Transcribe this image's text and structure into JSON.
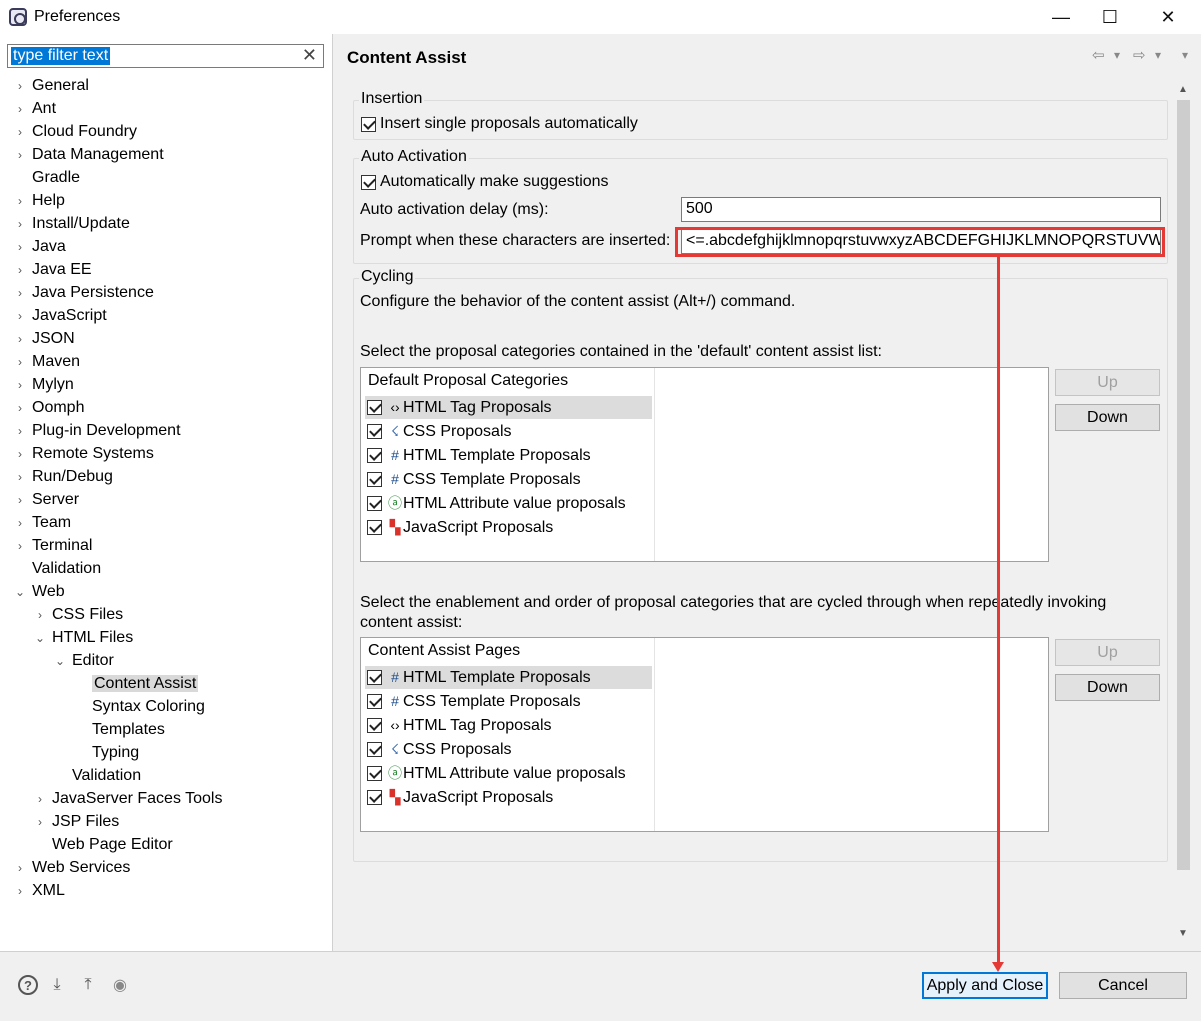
{
  "window": {
    "title": "Preferences",
    "minimize": "—",
    "maximize": "☐",
    "close": "✕"
  },
  "filter": {
    "placeholder": "type filter text",
    "clear": "✕"
  },
  "tree": [
    {
      "label": "General",
      "level": 0,
      "arrow": "›"
    },
    {
      "label": "Ant",
      "level": 0,
      "arrow": "›"
    },
    {
      "label": "Cloud Foundry",
      "level": 0,
      "arrow": "›"
    },
    {
      "label": "Data Management",
      "level": 0,
      "arrow": "›"
    },
    {
      "label": "Gradle",
      "level": 0,
      "arrow": ""
    },
    {
      "label": "Help",
      "level": 0,
      "arrow": "›"
    },
    {
      "label": "Install/Update",
      "level": 0,
      "arrow": "›"
    },
    {
      "label": "Java",
      "level": 0,
      "arrow": "›"
    },
    {
      "label": "Java EE",
      "level": 0,
      "arrow": "›"
    },
    {
      "label": "Java Persistence",
      "level": 0,
      "arrow": "›"
    },
    {
      "label": "JavaScript",
      "level": 0,
      "arrow": "›"
    },
    {
      "label": "JSON",
      "level": 0,
      "arrow": "›"
    },
    {
      "label": "Maven",
      "level": 0,
      "arrow": "›"
    },
    {
      "label": "Mylyn",
      "level": 0,
      "arrow": "›"
    },
    {
      "label": "Oomph",
      "level": 0,
      "arrow": "›"
    },
    {
      "label": "Plug-in Development",
      "level": 0,
      "arrow": "›"
    },
    {
      "label": "Remote Systems",
      "level": 0,
      "arrow": "›"
    },
    {
      "label": "Run/Debug",
      "level": 0,
      "arrow": "›"
    },
    {
      "label": "Server",
      "level": 0,
      "arrow": "›"
    },
    {
      "label": "Team",
      "level": 0,
      "arrow": "›"
    },
    {
      "label": "Terminal",
      "level": 0,
      "arrow": "›"
    },
    {
      "label": "Validation",
      "level": 0,
      "arrow": ""
    },
    {
      "label": "Web",
      "level": 0,
      "arrow": "⌄"
    },
    {
      "label": "CSS Files",
      "level": 1,
      "arrow": "›"
    },
    {
      "label": "HTML Files",
      "level": 1,
      "arrow": "⌄"
    },
    {
      "label": "Editor",
      "level": 2,
      "arrow": "⌄"
    },
    {
      "label": "Content Assist",
      "level": 3,
      "arrow": "",
      "selected": true
    },
    {
      "label": "Syntax Coloring",
      "level": 3,
      "arrow": ""
    },
    {
      "label": "Templates",
      "level": 3,
      "arrow": ""
    },
    {
      "label": "Typing",
      "level": 3,
      "arrow": ""
    },
    {
      "label": "Validation",
      "level": 2,
      "arrow": ""
    },
    {
      "label": "JavaServer Faces Tools",
      "level": 1,
      "arrow": "›"
    },
    {
      "label": "JSP Files",
      "level": 1,
      "arrow": "›"
    },
    {
      "label": "Web Page Editor",
      "level": 1,
      "arrow": ""
    },
    {
      "label": "Web Services",
      "level": 0,
      "arrow": "›"
    },
    {
      "label": "XML",
      "level": 0,
      "arrow": "›"
    }
  ],
  "page": {
    "heading": "Content Assist",
    "nav": {
      "back": "⇦",
      "back_menu": "▾",
      "forward": "⇨",
      "forward_menu": "▾",
      "view_menu": "▾"
    }
  },
  "insertion": {
    "legend": "Insertion",
    "single_proposals_label": "Insert single proposals automatically",
    "single_proposals_checked": true
  },
  "auto_activation": {
    "legend": "Auto Activation",
    "make_suggestions_label": "Automatically make suggestions",
    "make_suggestions_checked": true,
    "delay_label": "Auto activation delay (ms):",
    "delay_value": "500",
    "prompt_label": "Prompt when these characters are inserted:",
    "prompt_value": "<=.abcdefghijklmnopqrstuvwxyzABCDEFGHIJKLMNOPQRSTUVW"
  },
  "cycling": {
    "legend": "Cycling",
    "description": "Configure the behavior of the content assist (Alt+/) command.",
    "default_list_label": "Select the proposal categories contained in the 'default' content assist list:",
    "default_list_header": "Default Proposal Categories",
    "default_list": [
      {
        "icon": "‹›",
        "icon_name": "html-tag-icon",
        "label": "HTML Tag Proposals",
        "checked": true,
        "highlight": true
      },
      {
        "icon": "☇",
        "icon_name": "css-icon",
        "label": "CSS Proposals",
        "checked": true
      },
      {
        "icon": "#",
        "icon_name": "template-icon",
        "label": "HTML Template Proposals",
        "checked": true
      },
      {
        "icon": "#",
        "icon_name": "template-icon",
        "label": "CSS Template Proposals",
        "checked": true
      },
      {
        "icon": "ⓐ",
        "icon_name": "attribute-icon",
        "label": "HTML Attribute value proposals",
        "checked": true
      },
      {
        "icon": "▚",
        "icon_name": "javascript-icon",
        "label": "JavaScript Proposals",
        "checked": true
      }
    ],
    "cycle_list_label": "Select the enablement and order of proposal categories that are cycled through when repeatedly invoking content assist:",
    "cycle_list_header": "Content Assist Pages",
    "cycle_list": [
      {
        "icon": "#",
        "icon_name": "template-icon",
        "label": "HTML Template Proposals",
        "checked": true,
        "highlight": true
      },
      {
        "icon": "#",
        "icon_name": "template-icon",
        "label": "CSS Template Proposals",
        "checked": true
      },
      {
        "icon": "‹›",
        "icon_name": "html-tag-icon",
        "label": "HTML Tag Proposals",
        "checked": true
      },
      {
        "icon": "☇",
        "icon_name": "css-icon",
        "label": "CSS Proposals",
        "checked": true
      },
      {
        "icon": "ⓐ",
        "icon_name": "attribute-icon",
        "label": "HTML Attribute value proposals",
        "checked": true
      },
      {
        "icon": "▚",
        "icon_name": "javascript-icon",
        "label": "JavaScript Proposals",
        "checked": true
      }
    ],
    "up_label": "Up",
    "down_label": "Down"
  },
  "footer": {
    "icons": [
      {
        "name": "help-icon",
        "glyph": "?"
      },
      {
        "name": "import-icon",
        "glyph": "⤓"
      },
      {
        "name": "export-icon",
        "glyph": "⤒"
      },
      {
        "name": "oomph-record-icon",
        "glyph": "◉"
      }
    ],
    "apply_close": "Apply and Close",
    "cancel": "Cancel"
  },
  "colors": {
    "selection": "#0078d7",
    "annotation": "#e53935"
  }
}
